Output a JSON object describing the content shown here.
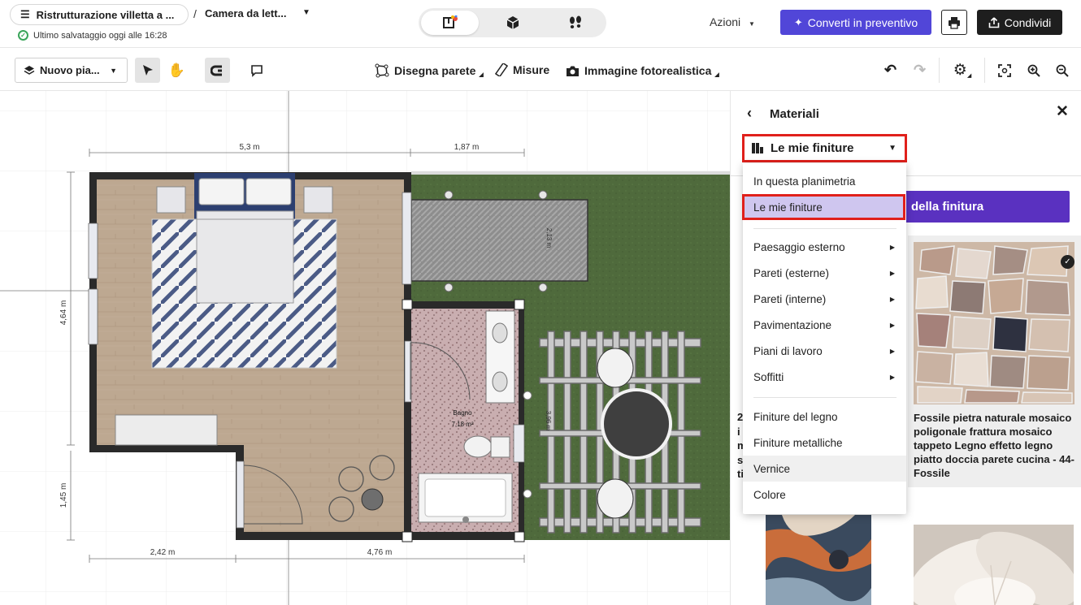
{
  "header": {
    "project_title": "Ristrutturazione villetta a ...",
    "separator": "/",
    "room_name": "Camera da lett...",
    "save_status": "Ultimo salvataggio oggi alle 16:28",
    "view_modes": [
      "2D",
      "3D",
      "walk"
    ],
    "active_view": "2D",
    "actions_label": "Azioni",
    "convert_label": "Converti in preventivo",
    "share_label": "Condividi"
  },
  "toolbar": {
    "floor_select": "Nuovo pia...",
    "draw_wall": "Disegna parete",
    "measures": "Misure",
    "photo_image": "Immagine fotorealistica"
  },
  "floorplan": {
    "dim_top_left": "5,3 m",
    "dim_top_right": "1,87 m",
    "dim_left_upper": "4,64 m",
    "dim_left_lower": "1,45 m",
    "dim_bottom_left": "2,42 m",
    "dim_bottom_right": "4,76 m",
    "dim_patio": "2,13 m",
    "dim_pergola": "3,96 m",
    "bath_label": "Bagno",
    "bath_area": "7,18 m²"
  },
  "panel": {
    "title": "Materiali",
    "dropdown_value": "Le mie finiture",
    "finish_button": "della finitura",
    "left_card_text": "2\ni\nm\ns\nti",
    "right_card_desc": "Fossile pietra naturale mosaico poligonale frattura mosaico tappeto Legno effetto legno piatto doccia parete cucina - 44-Fossile"
  },
  "dropdown": {
    "items": [
      {
        "label": "In questa planimetria",
        "submenu": false
      },
      {
        "label": "Le mie finiture",
        "submenu": false,
        "selected": true
      },
      {
        "label": "Paesaggio esterno",
        "submenu": true
      },
      {
        "label": "Pareti (esterne)",
        "submenu": true
      },
      {
        "label": "Pareti (interne)",
        "submenu": true
      },
      {
        "label": "Pavimentazione",
        "submenu": true
      },
      {
        "label": "Piani di lavoro",
        "submenu": true
      },
      {
        "label": "Soffitti",
        "submenu": true
      },
      {
        "label": "Finiture del legno",
        "submenu": false
      },
      {
        "label": "Finiture metalliche",
        "submenu": false
      },
      {
        "label": "Vernice",
        "submenu": false,
        "hovered": true
      },
      {
        "label": "Colore",
        "submenu": false
      }
    ]
  },
  "colors": {
    "accent": "#5146d8",
    "finish_button": "#5a31c0",
    "highlight": "#e0201b",
    "selected_bg": "#cfc6ef",
    "grass": "#4f6a3c",
    "wood_floor": "#bba68f"
  }
}
